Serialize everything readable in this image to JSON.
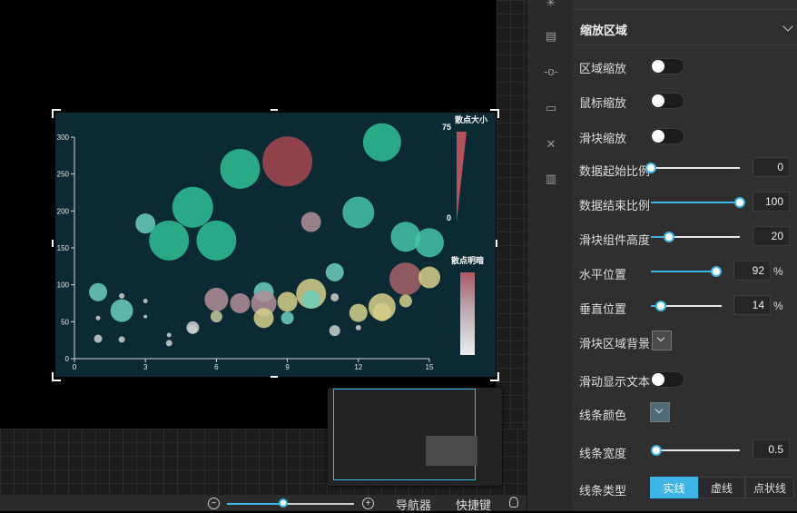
{
  "chart_data": {
    "type": "scatter",
    "xlim": [
      0,
      15
    ],
    "ylim": [
      0,
      300
    ],
    "xticks": [
      0,
      3,
      6,
      9,
      12,
      15
    ],
    "yticks": [
      0,
      50,
      100,
      150,
      200,
      250,
      300
    ],
    "series": [
      {
        "points": [
          {
            "x": 1,
            "y": 90,
            "size": 20,
            "color": "#6ccfbd"
          },
          {
            "x": 1,
            "y": 55,
            "size": 5,
            "color": "#cfcfcf"
          },
          {
            "x": 1,
            "y": 27,
            "size": 9,
            "color": "#cfcfcf"
          },
          {
            "x": 2,
            "y": 65,
            "size": 25,
            "color": "#6ccfbd"
          },
          {
            "x": 2,
            "y": 85,
            "size": 6,
            "color": "#cfcfcf"
          },
          {
            "x": 2,
            "y": 26,
            "size": 7,
            "color": "#cfcfcf"
          },
          {
            "x": 3,
            "y": 78,
            "size": 5,
            "color": "#cfcfcf"
          },
          {
            "x": 3,
            "y": 57,
            "size": 4,
            "color": "#cfcfcf"
          },
          {
            "x": 3,
            "y": 183,
            "size": 22,
            "color": "#6ccfbd"
          },
          {
            "x": 4,
            "y": 160,
            "size": 44,
            "color": "#2fc095"
          },
          {
            "x": 4,
            "y": 32,
            "size": 5,
            "color": "#cfcfcf"
          },
          {
            "x": 4,
            "y": 21,
            "size": 7,
            "color": "#cfcfcf"
          },
          {
            "x": 5,
            "y": 205,
            "size": 45,
            "color": "#2fc095"
          },
          {
            "x": 5,
            "y": 42,
            "size": 14,
            "color": "#cfcfcf"
          },
          {
            "x": 5,
            "y": 40,
            "size": 10,
            "color": "#cfcfcf"
          },
          {
            "x": 6,
            "y": 160,
            "size": 44,
            "color": "#2fc095"
          },
          {
            "x": 6,
            "y": 80,
            "size": 26,
            "color": "#b38e9a"
          },
          {
            "x": 6,
            "y": 57,
            "size": 13,
            "color": "#c7c7a0"
          },
          {
            "x": 7,
            "y": 257,
            "size": 44,
            "color": "#2fc095"
          },
          {
            "x": 7,
            "y": 75,
            "size": 22,
            "color": "#b38e9a"
          },
          {
            "x": 8,
            "y": 90,
            "size": 22,
            "color": "#6ccfbd"
          },
          {
            "x": 8,
            "y": 75,
            "size": 28,
            "color": "#b38e9a"
          },
          {
            "x": 8,
            "y": 55,
            "size": 22,
            "color": "#d6cf8a"
          },
          {
            "x": 9,
            "y": 267,
            "size": 55,
            "color": "#a84650"
          },
          {
            "x": 9,
            "y": 77,
            "size": 22,
            "color": "#d6cf8a"
          },
          {
            "x": 9,
            "y": 55,
            "size": 14,
            "color": "#6ccfbd"
          },
          {
            "x": 10,
            "y": 185,
            "size": 22,
            "color": "#b38e9a"
          },
          {
            "x": 10,
            "y": 88,
            "size": 33,
            "color": "#d6cf8a"
          },
          {
            "x": 10,
            "y": 80,
            "size": 20,
            "color": "#6ccfbd"
          },
          {
            "x": 11,
            "y": 117,
            "size": 20,
            "color": "#6ccfbd"
          },
          {
            "x": 11,
            "y": 83,
            "size": 9,
            "color": "#cfcfcf"
          },
          {
            "x": 11,
            "y": 38,
            "size": 12,
            "color": "#cfcfcf"
          },
          {
            "x": 12,
            "y": 198,
            "size": 35,
            "color": "#46c3a8"
          },
          {
            "x": 12,
            "y": 62,
            "size": 20,
            "color": "#d6cf8a"
          },
          {
            "x": 12,
            "y": 42,
            "size": 6,
            "color": "#cfcfcf"
          },
          {
            "x": 13,
            "y": 293,
            "size": 42,
            "color": "#2fc095"
          },
          {
            "x": 13,
            "y": 70,
            "size": 30,
            "color": "#d6cf8a"
          },
          {
            "x": 13,
            "y": 63,
            "size": 20,
            "color": "#d6cf8a"
          },
          {
            "x": 14,
            "y": 165,
            "size": 33,
            "color": "#46c3a8"
          },
          {
            "x": 14,
            "y": 108,
            "size": 36,
            "color": "#a86068"
          },
          {
            "x": 14,
            "y": 78,
            "size": 14,
            "color": "#d6cf8a"
          },
          {
            "x": 15,
            "y": 157,
            "size": 32,
            "color": "#46c3a8"
          },
          {
            "x": 15,
            "y": 110,
            "size": 24,
            "color": "#d6cf8a"
          }
        ]
      }
    ],
    "legend_size": {
      "title": "散点大小",
      "max_label": "75",
      "min_label": "0",
      "color": "#b2525a"
    },
    "legend_opacity": {
      "title": "散点明暗"
    }
  },
  "bottom_bar": {
    "zoom_minus": "−",
    "zoom_plus": "+",
    "navigator": "导航器",
    "shortcuts": "快捷键"
  },
  "panel": {
    "title": "缩放区域",
    "rows": {
      "area_zoom": {
        "label": "区域缩放"
      },
      "mouse_zoom": {
        "label": "鼠标缩放"
      },
      "slider_zoom": {
        "label": "滑块缩放"
      },
      "start_ratio": {
        "label": "数据起始比例",
        "value": "0"
      },
      "end_ratio": {
        "label": "数据结束比例",
        "value": "100"
      },
      "slider_height": {
        "label": "滑块组件高度",
        "value": "20"
      },
      "h_position": {
        "label": "水平位置",
        "value": "92",
        "unit": "%"
      },
      "v_position": {
        "label": "垂直位置",
        "value": "14",
        "unit": "%"
      },
      "slider_bg": {
        "label": "滑块区域背景"
      },
      "slide_text": {
        "label": "滑动显示文本"
      },
      "line_color": {
        "label": "线条颜色"
      },
      "line_width": {
        "label": "线条宽度",
        "value": "0.5"
      },
      "line_type": {
        "label": "线条类型",
        "options": [
          "实线",
          "虚线",
          "点状线"
        ]
      }
    }
  }
}
